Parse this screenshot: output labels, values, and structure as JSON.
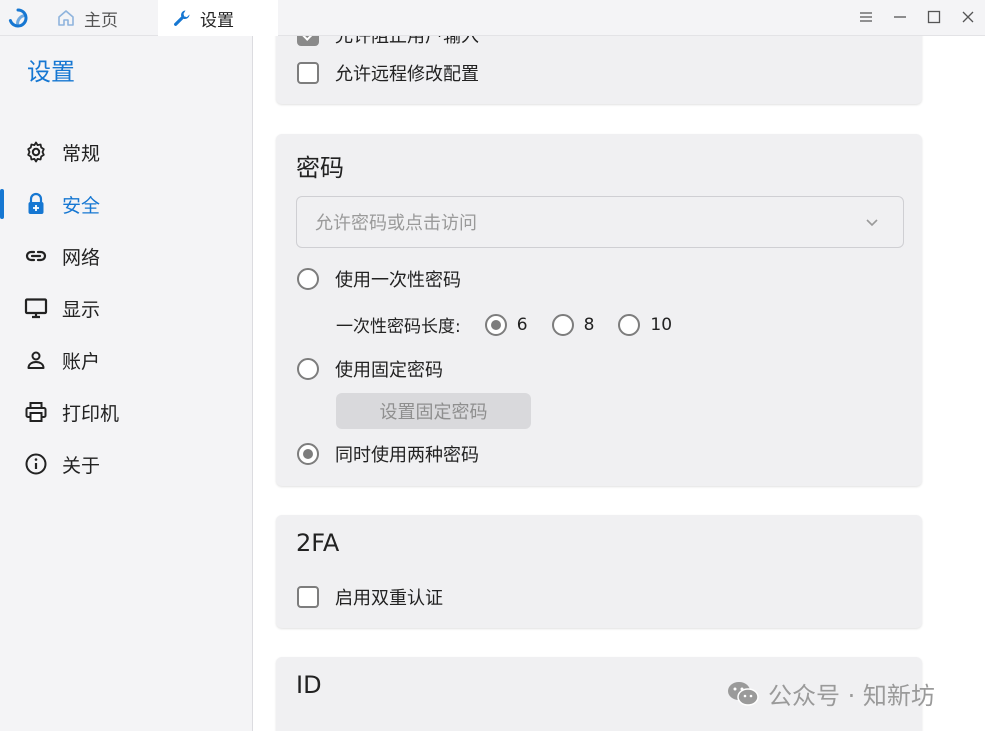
{
  "titlebar": {
    "tabs": [
      {
        "label": "主页",
        "icon": "home-icon"
      },
      {
        "label": "设置",
        "icon": "wrench-icon"
      }
    ],
    "window_controls": [
      "menu-icon",
      "minimize-icon",
      "maximize-icon",
      "close-icon"
    ]
  },
  "sidebar": {
    "title": "设置",
    "items": [
      {
        "label": "常规",
        "icon": "gear-icon"
      },
      {
        "label": "安全",
        "icon": "lock-icon",
        "active": true
      },
      {
        "label": "网络",
        "icon": "link-icon"
      },
      {
        "label": "显示",
        "icon": "monitor-icon"
      },
      {
        "label": "账户",
        "icon": "user-icon"
      },
      {
        "label": "打印机",
        "icon": "printer-icon"
      },
      {
        "label": "关于",
        "icon": "info-icon"
      }
    ]
  },
  "top_card": {
    "partial_checkbox": {
      "label": "允许阻止用户输入",
      "checked": true
    },
    "remote_config": {
      "label": "允许远程修改配置",
      "checked": false
    }
  },
  "password_card": {
    "title": "密码",
    "select": {
      "placeholder": "允许密码或点击访问"
    },
    "one_time": {
      "label": "使用一次性密码",
      "checked": false
    },
    "length": {
      "label": "一次性密码长度:",
      "options": [
        {
          "value": "6",
          "checked": true
        },
        {
          "value": "8",
          "checked": false
        },
        {
          "value": "10",
          "checked": false
        }
      ]
    },
    "fixed": {
      "label": "使用固定密码",
      "checked": false
    },
    "set_fixed_button": "设置固定密码",
    "both": {
      "label": "同时使用两种密码",
      "checked": true
    }
  },
  "twofa_card": {
    "title": "2FA",
    "enable": {
      "label": "启用双重认证",
      "checked": false
    }
  },
  "id_card": {
    "title": "ID"
  },
  "watermark": {
    "text": "公众号 · 知新坊"
  },
  "colors": {
    "accent": "#1677d2",
    "card_bg": "#f0f0f2",
    "sidebar_bg": "#f4f4f6"
  }
}
